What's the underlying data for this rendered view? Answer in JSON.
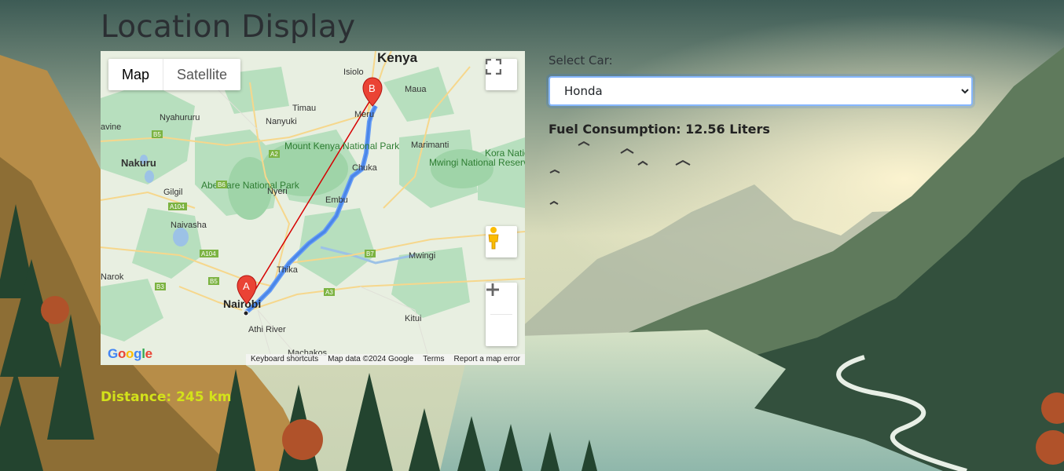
{
  "page": {
    "title": "Location Display"
  },
  "map": {
    "map_type_tabs": [
      {
        "label": "Map",
        "active": true
      },
      {
        "label": "Satellite",
        "active": false
      }
    ],
    "place_labels": [
      "Kenya",
      "Isiolo",
      "Maua",
      "Meru",
      "Timau",
      "Nanyuki",
      "Nyahururu",
      "Marimanti",
      "Mount Kenya National Park",
      "Nakuru",
      "Aberdare National Park",
      "Chuka",
      "Mwingi National Reserve",
      "Kora National",
      "Gilgil",
      "Nyeri",
      "Embu",
      "Naivasha",
      "Mwingi",
      "Narok",
      "Thika",
      "Nairobi",
      "Kitui",
      "Athi River",
      "Machakos",
      "avine"
    ],
    "road_labels": [
      "B5",
      "A2",
      "B6",
      "A104",
      "B7",
      "A3",
      "B3",
      "A104",
      "B5"
    ],
    "markers": [
      {
        "label": "A"
      },
      {
        "label": "B"
      }
    ],
    "footer": {
      "keyboard": "Keyboard shortcuts",
      "data": "Map data ©2024 Google",
      "terms": "Terms",
      "report": "Report a map error"
    },
    "logo": "Google",
    "controls": [
      "fullscreen-icon",
      "pegman-icon",
      "zoom-in-icon",
      "zoom-out-icon"
    ]
  },
  "distance": {
    "text": "Distance: 245 km",
    "color": "#d3e21a"
  },
  "car": {
    "label": "Select Car:",
    "selected": "Honda"
  },
  "fuel": {
    "text": "Fuel Consumption: 12.56 Liters"
  }
}
